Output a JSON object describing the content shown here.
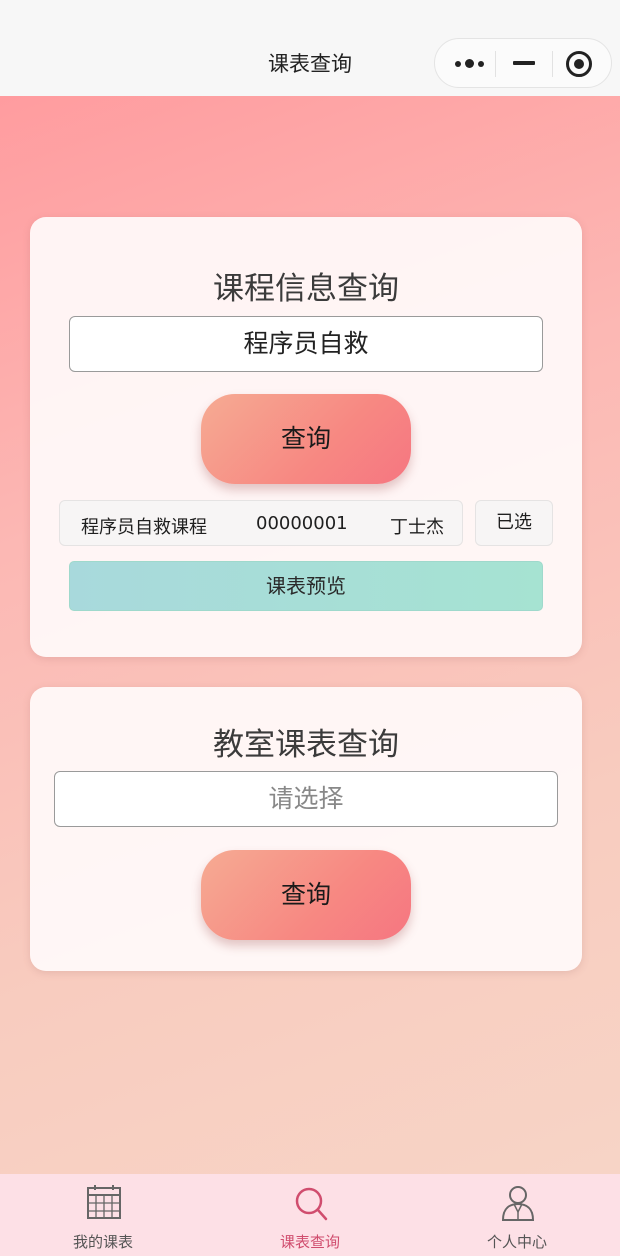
{
  "nav": {
    "title": "课表查询"
  },
  "course_query": {
    "title": "课程信息查询",
    "input_value": "程序员自救",
    "query_label": "查询",
    "result": {
      "name": "程序员自救课程",
      "code": "00000001",
      "teacher": "丁士杰",
      "status": "已选"
    },
    "preview_label": "课表预览"
  },
  "classroom_query": {
    "title": "教室课表查询",
    "select_placeholder": "请选择",
    "query_label": "查询"
  },
  "tabbar": {
    "items": [
      {
        "label": "我的课表",
        "icon": "calendar-grid-icon"
      },
      {
        "label": "课表查询",
        "icon": "search-icon",
        "active": true
      },
      {
        "label": "个人中心",
        "icon": "user-icon"
      }
    ],
    "active_color": "#d04d6e"
  },
  "colors": {
    "button_gradient": [
      "#f6ab93",
      "#f67681"
    ],
    "preview_gradient": [
      "#a8d9dc",
      "#a6e3d2"
    ],
    "tabbar_bg": "#fde0e6"
  }
}
